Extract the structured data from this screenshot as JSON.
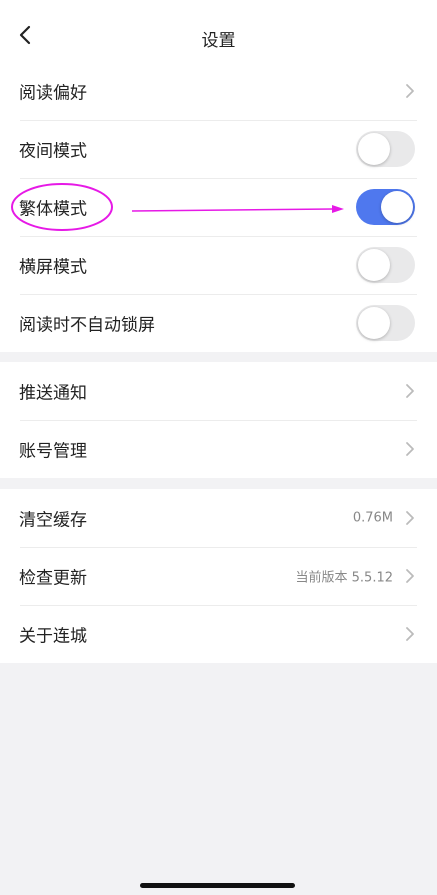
{
  "header": {
    "title": "设置",
    "back_icon": "chevron-left-icon"
  },
  "groups": [
    {
      "rows": [
        {
          "label": "阅读偏好",
          "type": "chevron"
        },
        {
          "label": "夜间模式",
          "type": "toggle",
          "on": false
        },
        {
          "label": "繁体模式",
          "type": "toggle",
          "on": true
        },
        {
          "label": "横屏模式",
          "type": "toggle",
          "on": false
        },
        {
          "label": "阅读时不自动锁屏",
          "type": "toggle",
          "on": false
        }
      ]
    },
    {
      "rows": [
        {
          "label": "推送通知",
          "type": "chevron"
        },
        {
          "label": "账号管理",
          "type": "chevron"
        }
      ]
    },
    {
      "rows": [
        {
          "label": "清空缓存",
          "type": "chevron",
          "value": "0.76M"
        },
        {
          "label": "检查更新",
          "type": "chevron",
          "value": "当前版本 5.5.12"
        },
        {
          "label": "关于连城",
          "type": "chevron"
        }
      ]
    }
  ],
  "colors": {
    "toggle_on": "#4f78ee",
    "toggle_off": "#e9e9ea",
    "annotation": "#e619e6"
  }
}
